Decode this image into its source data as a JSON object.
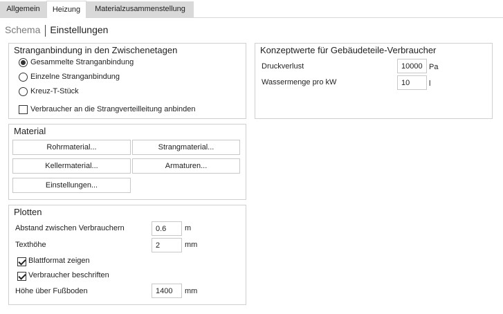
{
  "tabs": [
    {
      "label": "Allgemein",
      "active": false
    },
    {
      "label": "Heizung",
      "active": true
    },
    {
      "label": "Materialzusammenstellung",
      "active": false
    }
  ],
  "subnav": {
    "schema": "Schema",
    "einstellungen": "Einstellungen"
  },
  "stranganbindung": {
    "title": "Stranganbindung in den Zwischenetagen",
    "options": [
      {
        "label": "Gesammelte Stranganbindung",
        "selected": true
      },
      {
        "label": "Einzelne Stranganbindung",
        "selected": false
      },
      {
        "label": "Kreuz-T-Stück",
        "selected": false
      }
    ],
    "checkbox": {
      "label": "Verbraucher an die Strangverteilleitung anbinden",
      "checked": false
    }
  },
  "material": {
    "title": "Material",
    "buttons": {
      "rohrmaterial": "Rohrmaterial...",
      "strangmaterial": "Strangmaterial...",
      "kellermaterial": "Kellermaterial...",
      "armaturen": "Armaturen...",
      "einstellungen": "Einstellungen..."
    }
  },
  "plotten": {
    "title": "Plotten",
    "abstand": {
      "label": "Abstand zwischen Verbrauchern",
      "value": "0.6",
      "unit": "m"
    },
    "texthoehe": {
      "label": "Texthöhe",
      "value": "2",
      "unit": "mm"
    },
    "blattformat": {
      "label": "Blattformat zeigen",
      "checked": true
    },
    "beschriften": {
      "label": "Verbraucher beschriften",
      "checked": true
    },
    "hoehe": {
      "label": "Höhe über Fußboden",
      "value": "1400",
      "unit": "mm"
    }
  },
  "konzept": {
    "title": "Konzeptwerte für Gebäudeteile-Verbraucher",
    "druckverlust": {
      "label": "Druckverlust",
      "value": "10000",
      "unit": "Pa"
    },
    "wassermenge": {
      "label": "Wassermenge pro kW",
      "value": "10",
      "unit": "l"
    }
  }
}
